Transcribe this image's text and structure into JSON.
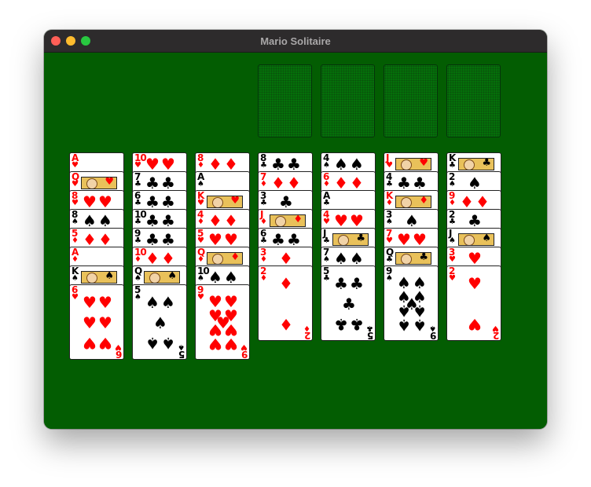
{
  "window": {
    "title": "Mario Solitaire"
  },
  "suit_symbols": {
    "hearts": "♥",
    "diamonds": "♦",
    "clubs": "♣",
    "spades": "♠"
  },
  "colors": {
    "felt": "#035d02",
    "red": "#ff0000",
    "black": "#000000"
  },
  "foundations": [
    {
      "name": "foundation-1",
      "card": null
    },
    {
      "name": "foundation-2",
      "card": null
    },
    {
      "name": "foundation-3",
      "card": null
    },
    {
      "name": "foundation-4",
      "card": null
    }
  ],
  "tableau": [
    [
      {
        "rank": "A",
        "suit": "hearts"
      },
      {
        "rank": "Q",
        "suit": "hearts"
      },
      {
        "rank": "8",
        "suit": "hearts"
      },
      {
        "rank": "8",
        "suit": "spades"
      },
      {
        "rank": "5",
        "suit": "diamonds"
      },
      {
        "rank": "A",
        "suit": "diamonds"
      },
      {
        "rank": "K",
        "suit": "spades"
      },
      {
        "rank": "6",
        "suit": "hearts"
      }
    ],
    [
      {
        "rank": "10",
        "suit": "hearts"
      },
      {
        "rank": "7",
        "suit": "clubs"
      },
      {
        "rank": "6",
        "suit": "clubs"
      },
      {
        "rank": "10",
        "suit": "clubs"
      },
      {
        "rank": "9",
        "suit": "clubs"
      },
      {
        "rank": "10",
        "suit": "diamonds"
      },
      {
        "rank": "Q",
        "suit": "spades"
      },
      {
        "rank": "5",
        "suit": "spades"
      }
    ],
    [
      {
        "rank": "8",
        "suit": "diamonds"
      },
      {
        "rank": "A",
        "suit": "spades"
      },
      {
        "rank": "K",
        "suit": "hearts"
      },
      {
        "rank": "4",
        "suit": "diamonds"
      },
      {
        "rank": "5",
        "suit": "hearts"
      },
      {
        "rank": "Q",
        "suit": "diamonds"
      },
      {
        "rank": "10",
        "suit": "spades"
      },
      {
        "rank": "9",
        "suit": "hearts"
      }
    ],
    [
      {
        "rank": "8",
        "suit": "clubs"
      },
      {
        "rank": "7",
        "suit": "diamonds"
      },
      {
        "rank": "3",
        "suit": "clubs"
      },
      {
        "rank": "J",
        "suit": "diamonds"
      },
      {
        "rank": "6",
        "suit": "clubs"
      },
      {
        "rank": "3",
        "suit": "diamonds"
      },
      {
        "rank": "2",
        "suit": "diamonds"
      }
    ],
    [
      {
        "rank": "4",
        "suit": "spades"
      },
      {
        "rank": "6",
        "suit": "diamonds"
      },
      {
        "rank": "A",
        "suit": "clubs"
      },
      {
        "rank": "4",
        "suit": "hearts"
      },
      {
        "rank": "J",
        "suit": "clubs"
      },
      {
        "rank": "7",
        "suit": "spades"
      },
      {
        "rank": "5",
        "suit": "clubs"
      }
    ],
    [
      {
        "rank": "J",
        "suit": "hearts"
      },
      {
        "rank": "4",
        "suit": "clubs"
      },
      {
        "rank": "K",
        "suit": "diamonds"
      },
      {
        "rank": "3",
        "suit": "spades"
      },
      {
        "rank": "7",
        "suit": "hearts"
      },
      {
        "rank": "Q",
        "suit": "clubs"
      },
      {
        "rank": "9",
        "suit": "spades"
      }
    ],
    [
      {
        "rank": "K",
        "suit": "clubs"
      },
      {
        "rank": "2",
        "suit": "spades"
      },
      {
        "rank": "9",
        "suit": "diamonds"
      },
      {
        "rank": "2",
        "suit": "clubs"
      },
      {
        "rank": "J",
        "suit": "spades"
      },
      {
        "rank": "3",
        "suit": "hearts"
      },
      {
        "rank": "2",
        "suit": "hearts"
      }
    ]
  ]
}
